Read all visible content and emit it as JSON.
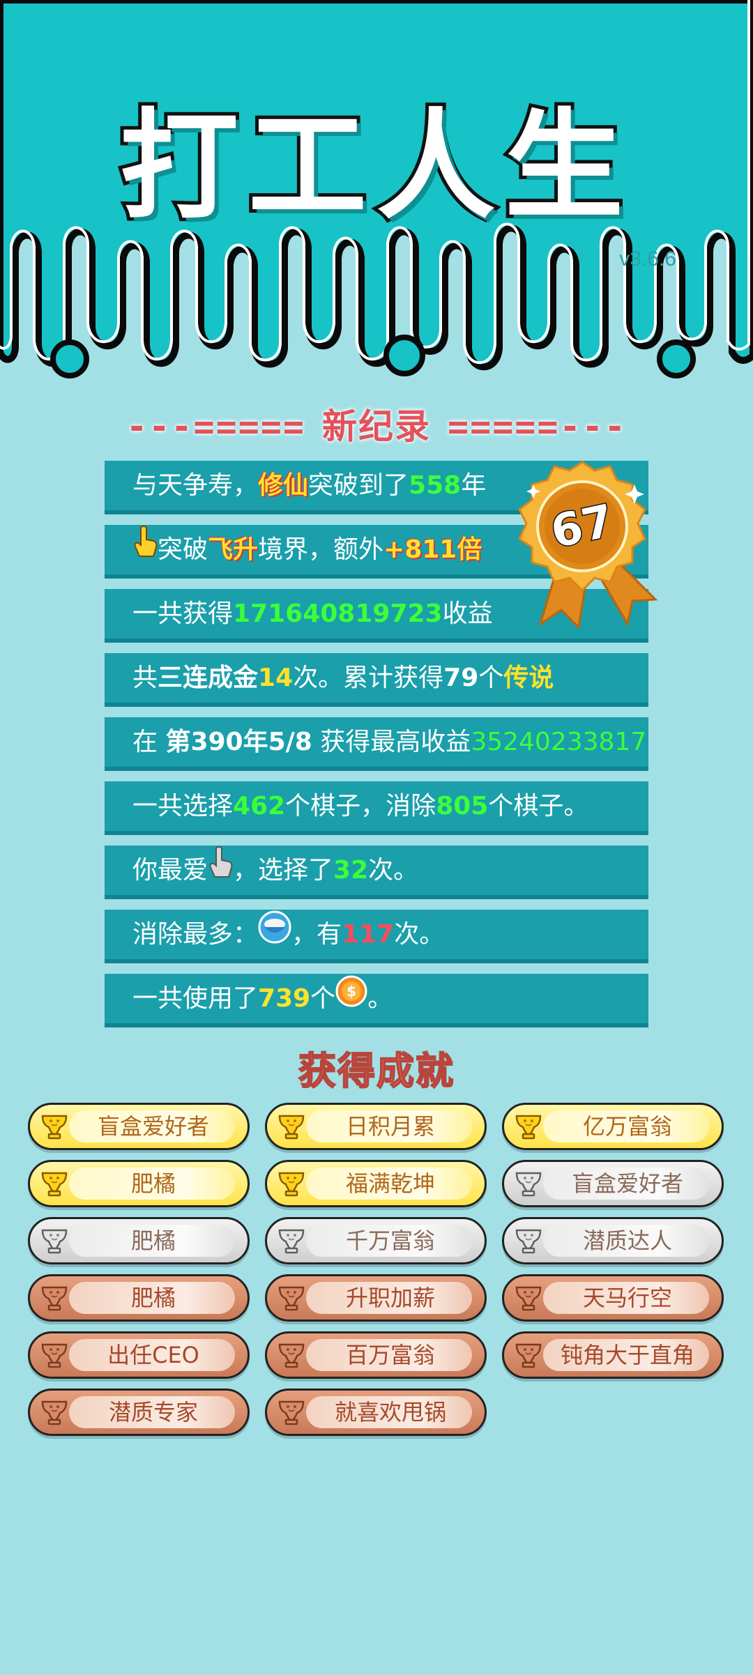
{
  "header": {
    "title": "打工人生",
    "version": "v3.6.6"
  },
  "record_banner": {
    "left_dashes": "---=====",
    "label": "新纪录",
    "right_dashes": "=====---"
  },
  "medal": {
    "value": "67"
  },
  "stats": {
    "row1": {
      "a": "与天争寿，",
      "b": "修仙",
      "c": "突破到了",
      "d": "558",
      "e": "年"
    },
    "row2": {
      "a": "突破",
      "b": "飞升",
      "c": "境界，额外",
      "d": "+811倍"
    },
    "row3": {
      "a": "一共获得",
      "b": "171640819723",
      "c": "收益"
    },
    "row4": {
      "a": "共",
      "b": "三连成金",
      "c": "14",
      "d": "次。累计获得",
      "e": "79",
      "f": "个",
      "g": "传说"
    },
    "row5": {
      "a": "在 ",
      "b": "第390年5/8",
      "c": " 获得最高收益",
      "d": "35240233817"
    },
    "row6": {
      "a": "一共选择",
      "b": "462",
      "c": "个棋子，消除",
      "d": "805",
      "e": "个棋子。"
    },
    "row7": {
      "a": "你最爱",
      "b": "，选择了",
      "c": "32",
      "d": "次。"
    },
    "row8": {
      "a": "消除最多：",
      "b": "，有",
      "c": "117",
      "d": "次。"
    },
    "row9": {
      "a": "一共使用了",
      "b": "739",
      "c": "个",
      "d": "。"
    }
  },
  "achievements_title": "获得成就",
  "achievements": [
    {
      "label": "盲盒爱好者",
      "tier": "gold"
    },
    {
      "label": "日积月累",
      "tier": "gold"
    },
    {
      "label": "亿万富翁",
      "tier": "gold"
    },
    {
      "label": "肥橘",
      "tier": "gold"
    },
    {
      "label": "福满乾坤",
      "tier": "gold"
    },
    {
      "label": "盲盒爱好者",
      "tier": "silver"
    },
    {
      "label": "肥橘",
      "tier": "silver"
    },
    {
      "label": "千万富翁",
      "tier": "silver"
    },
    {
      "label": "潜质达人",
      "tier": "silver"
    },
    {
      "label": "肥橘",
      "tier": "bronze"
    },
    {
      "label": "升职加薪",
      "tier": "bronze"
    },
    {
      "label": "天马行空",
      "tier": "bronze"
    },
    {
      "label": "出任CEO",
      "tier": "bronze"
    },
    {
      "label": "百万富翁",
      "tier": "bronze"
    },
    {
      "label": "钝角大于直角",
      "tier": "bronze"
    },
    {
      "label": "潜质专家",
      "tier": "bronze"
    },
    {
      "label": "就喜欢甩锅",
      "tier": "bronze"
    }
  ],
  "colors": {
    "top_teal": "#17c3c6",
    "page_bg": "#a2e0e6",
    "row_bg": "#1a9fab",
    "green": "#3cff3a",
    "yellow": "#ffe22a",
    "red": "#ff4a5a",
    "banner_red": "#e4515a"
  },
  "icons": {
    "pointer": "pointing-hand-icon",
    "piece": "rice-bowl-icon",
    "coin": "coin-icon",
    "trophy": "trophy-icon",
    "medal": "medal-badge-icon"
  }
}
